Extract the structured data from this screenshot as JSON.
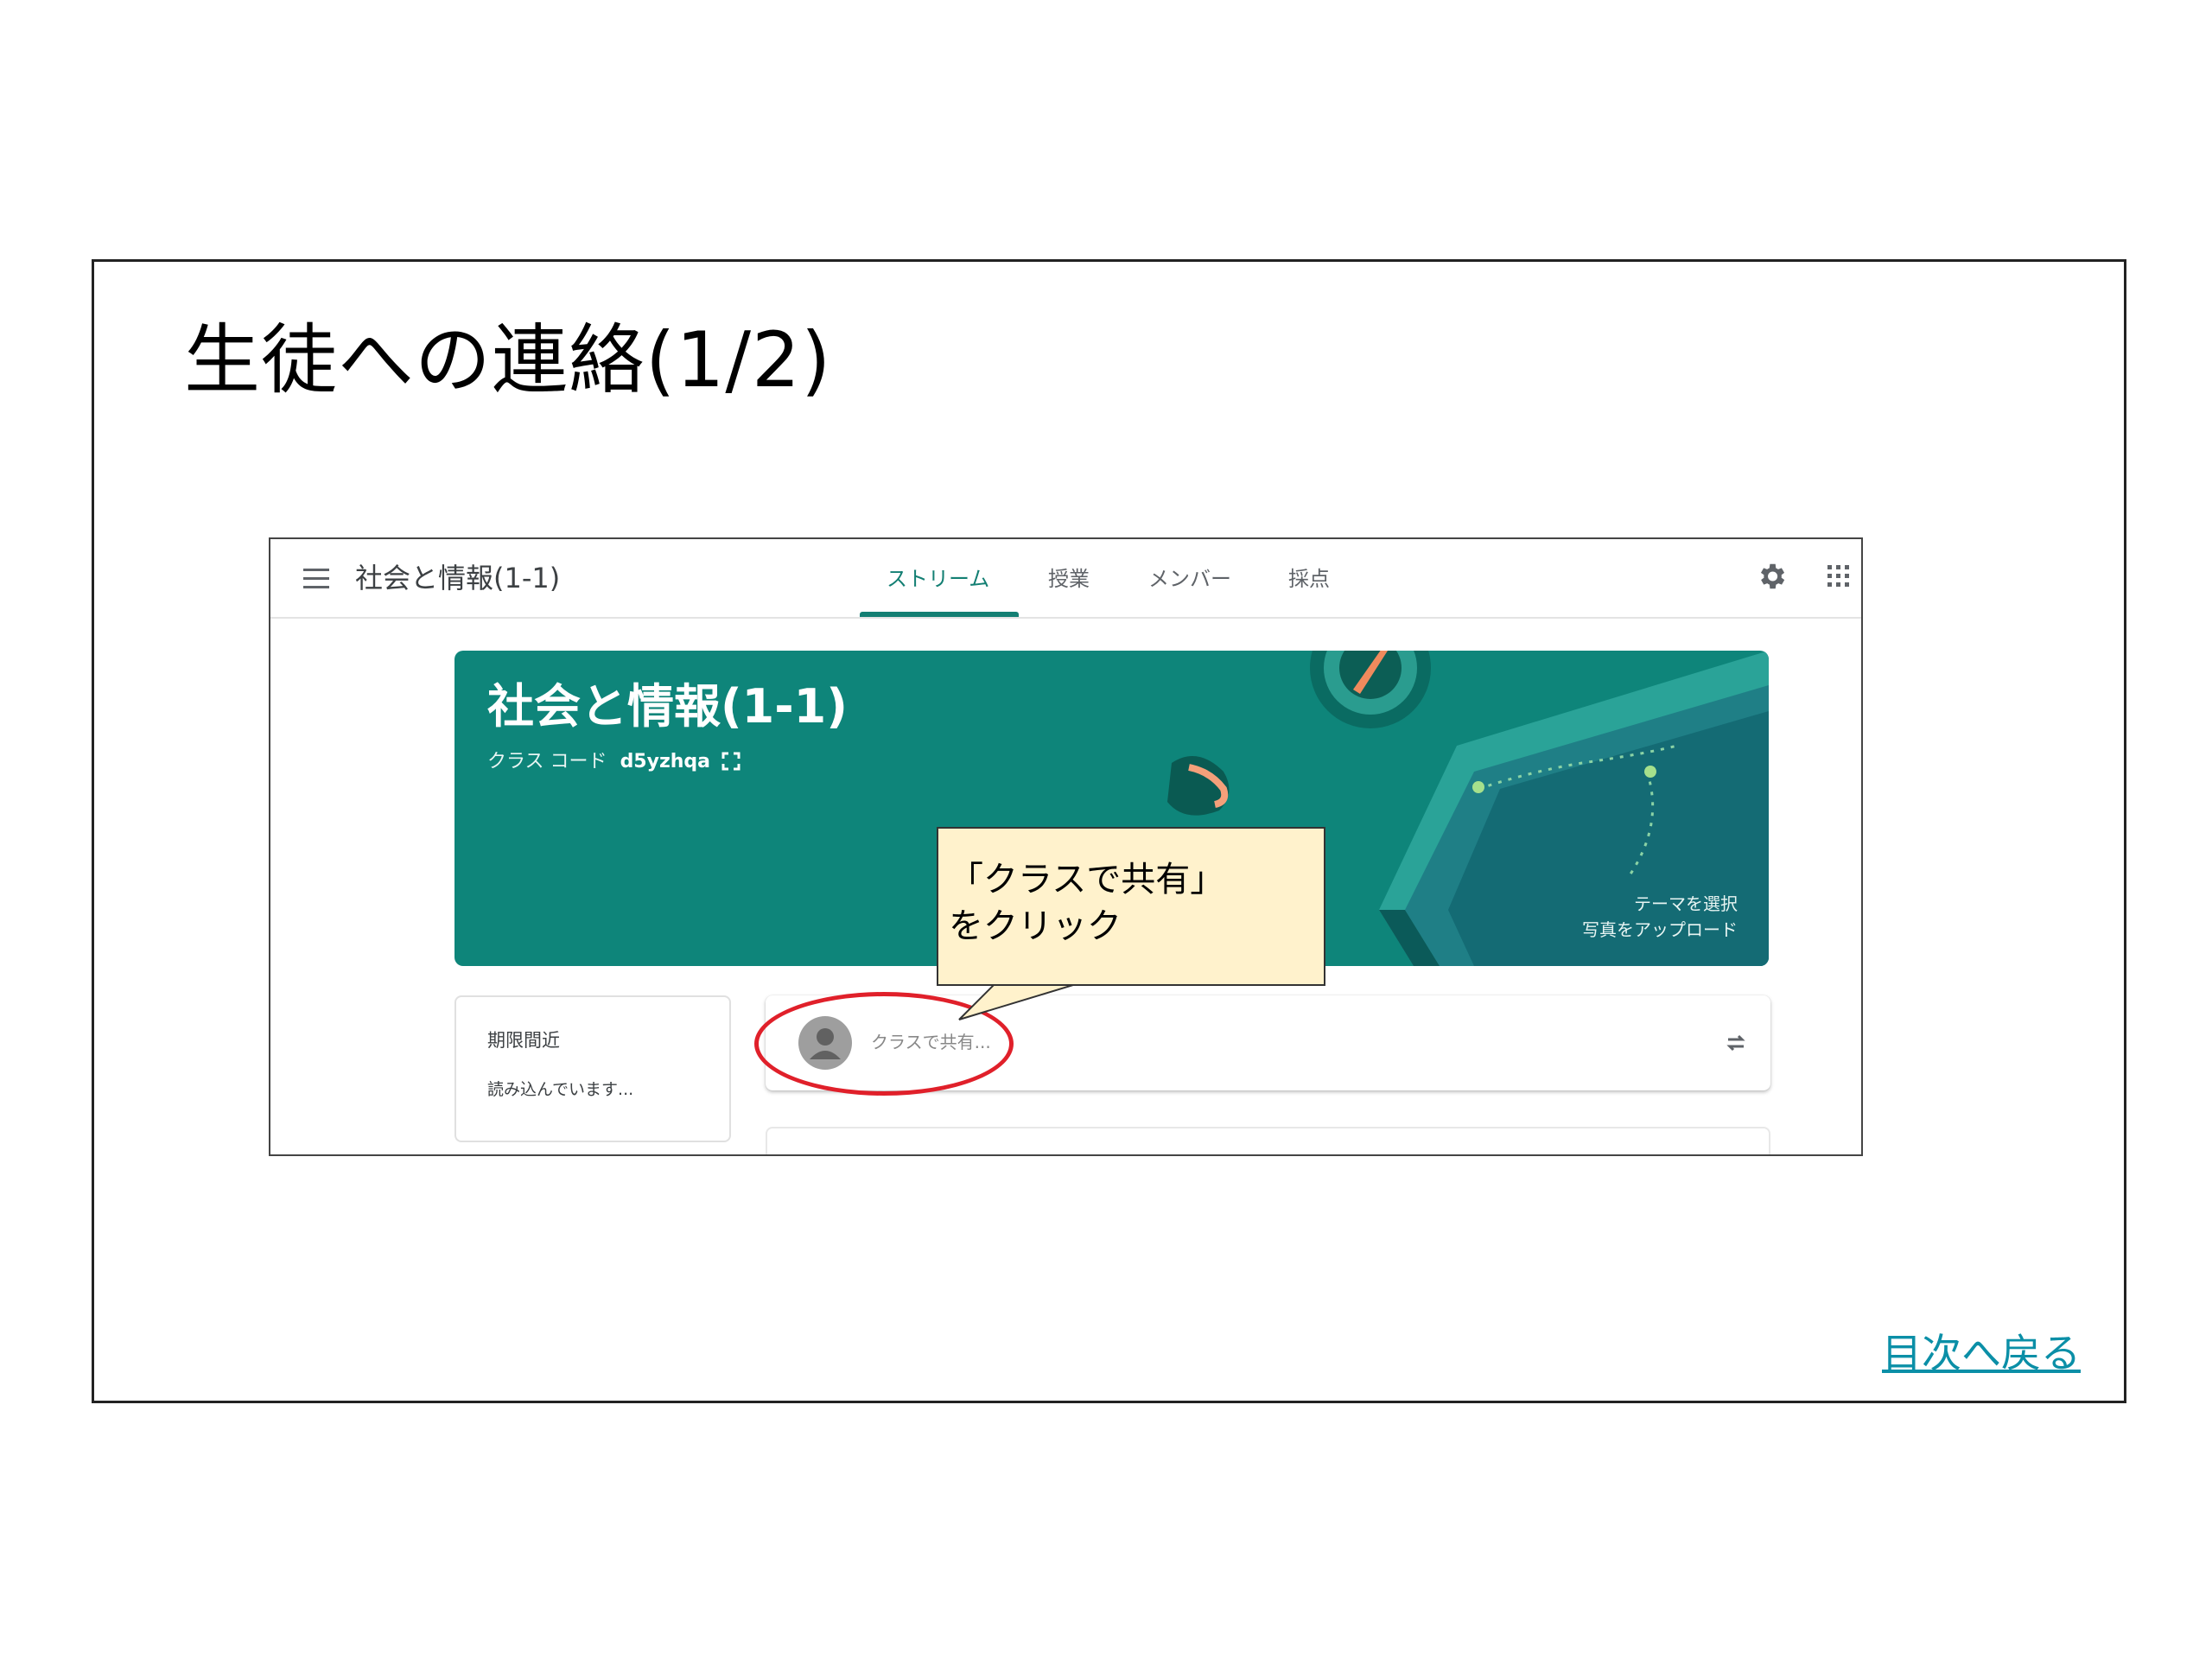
{
  "slide": {
    "title": "生徒への連絡(1/2)",
    "toc_link": "目次へ戻る"
  },
  "classroom": {
    "header": {
      "class_name": "社会と情報(1-1)",
      "tabs": [
        {
          "label": "ストリーム",
          "active": true
        },
        {
          "label": "授業",
          "active": false
        },
        {
          "label": "メンバー",
          "active": false
        },
        {
          "label": "採点",
          "active": false
        }
      ],
      "icons": [
        "menu-icon",
        "gear-icon",
        "apps-icon"
      ]
    },
    "banner": {
      "title": "社会と情報(1-1)",
      "code_label": "クラス コード",
      "code_value": "d5yzhqa",
      "select_theme": "テーマを選択",
      "upload_photo": "写真をアップロード",
      "color": "#0e857a"
    },
    "due": {
      "title": "期限間近",
      "status": "読み込んでいます..."
    },
    "share": {
      "placeholder": "クラスで共有..."
    }
  },
  "callout": {
    "line1": "「クラスで共有」",
    "line2": "をクリック",
    "background": "#fff2cc",
    "highlight_color": "#e0202a"
  }
}
